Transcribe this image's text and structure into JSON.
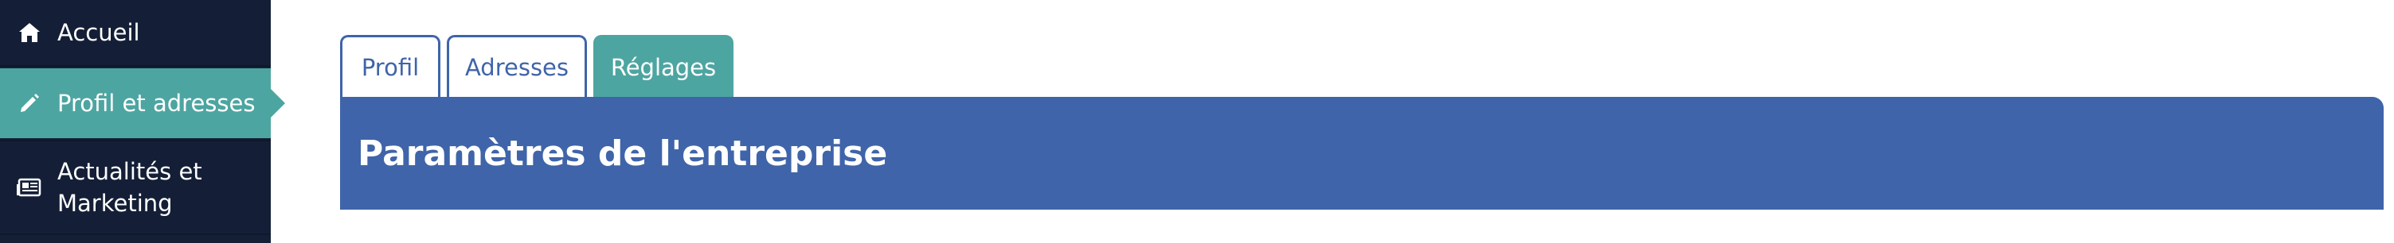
{
  "sidebar": {
    "items": [
      {
        "label": "Accueil",
        "icon": "home-icon"
      },
      {
        "label": "Profil et adresses",
        "icon": "pencil-icon",
        "active": true
      },
      {
        "label_line1": "Actualités et",
        "label_line2": "Marketing",
        "icon": "newspaper-icon"
      }
    ]
  },
  "tabs": [
    {
      "label": "Profil"
    },
    {
      "label": "Adresses"
    },
    {
      "label": "Réglages",
      "active": true
    }
  ],
  "panel": {
    "title": "Paramètres de l'entreprise"
  },
  "colors": {
    "sidebar_bg": "#141f37",
    "accent_teal": "#4da5a1",
    "primary_blue": "#3f64a9"
  }
}
